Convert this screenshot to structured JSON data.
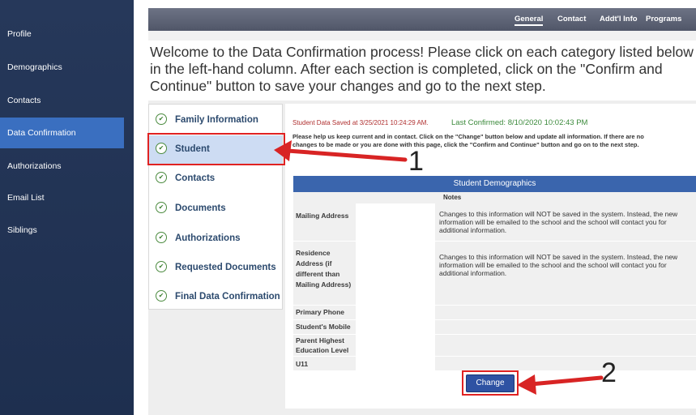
{
  "sidebar": {
    "items": [
      {
        "label": "Profile"
      },
      {
        "label": "Demographics"
      },
      {
        "label": "Contacts"
      },
      {
        "label": "Data Confirmation"
      },
      {
        "label": "Authorizations"
      },
      {
        "label": "Email List"
      },
      {
        "label": "Siblings"
      }
    ],
    "active_index": 3
  },
  "topnav": {
    "links": [
      {
        "label": "General"
      },
      {
        "label": "Contact"
      },
      {
        "label": "Addt'l Info"
      },
      {
        "label": "Programs"
      }
    ],
    "active_index": 0
  },
  "welcome_text": "Welcome to the Data Confirmation process! Please click on each category listed below in the left-hand column. After each section is completed, click on the \"Confirm and Continue\" button to save your changes and go to the next step.",
  "categories": [
    {
      "label": "Family Information"
    },
    {
      "label": "Student"
    },
    {
      "label": "Contacts"
    },
    {
      "label": "Documents"
    },
    {
      "label": "Authorizations"
    },
    {
      "label": "Requested Documents"
    },
    {
      "label": "Final Data Confirmation"
    }
  ],
  "selected_category_index": 1,
  "status": {
    "saved": "Student Data Saved at 3/25/2021 10:24:29 AM.",
    "last_confirmed": "Last Confirmed: 8/10/2020 10:02:43 PM"
  },
  "help_text": "Please help us keep current and in contact. Click on the \"Change\" button below and update all information. If there are no changes to be made or you are done with this page, click the \"Confirm and Continue\" button and go on to the next step.",
  "table": {
    "title": "Student Demographics",
    "notes_header": "Notes",
    "rows": [
      {
        "label": "Mailing Address",
        "value": "",
        "note": "Changes to this information will NOT be saved in the system. Instead, the new information will be emailed to the school and the school will contact you for additional information."
      },
      {
        "label": "Residence Address (if different than Mailing Address)",
        "value": "",
        "note": "Changes to this information will NOT be saved in the system. Instead, the new information will be emailed to the school and the school will contact you for additional information."
      },
      {
        "label": "Primary Phone",
        "value": "",
        "note": ""
      },
      {
        "label": "Student's Mobile",
        "value": "",
        "note": ""
      },
      {
        "label": "Parent Highest Education Level",
        "value": "",
        "note": ""
      },
      {
        "label": "U11",
        "value": "",
        "note": ""
      }
    ]
  },
  "change_button": {
    "label": "Change"
  },
  "annotations": {
    "one": "1",
    "two": "2"
  },
  "icons": {
    "category_status": "check-circle-icon"
  },
  "colors": {
    "sidebar": "#26385a",
    "active_nav": "#3a6fc0",
    "table_header": "#3a65ad",
    "highlight": "#e02222"
  }
}
